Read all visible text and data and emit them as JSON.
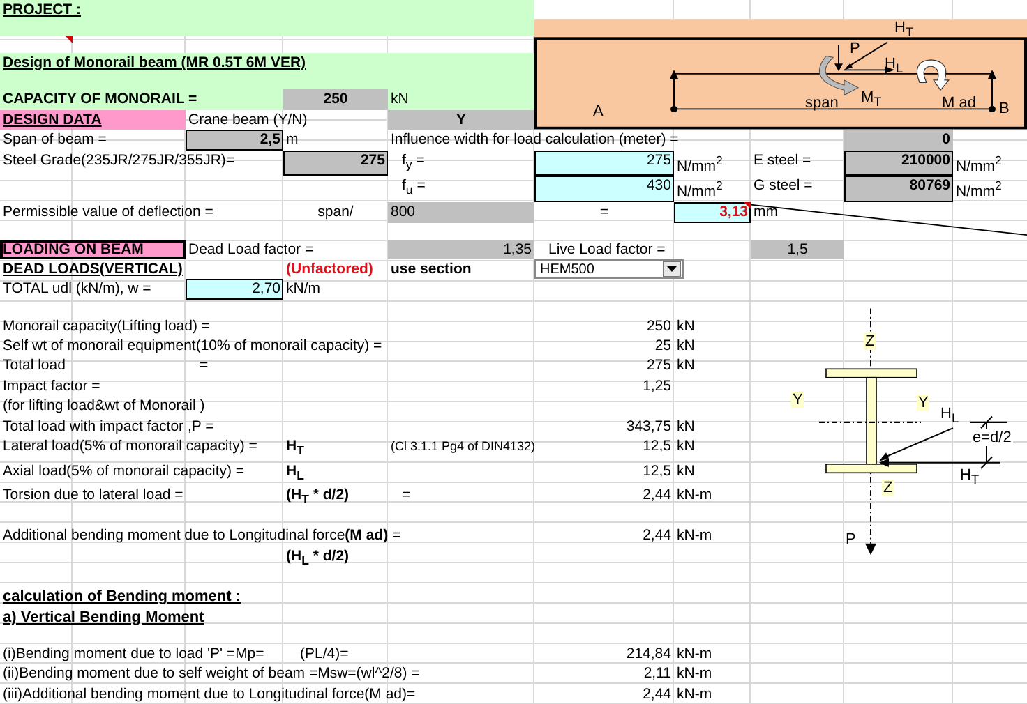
{
  "project_label": "PROJECT :",
  "title": "Design of Monorail beam (MR  0.5T  6M  VER)",
  "capacity": {
    "label": "CAPACITY OF MONORAIL =",
    "value": "250",
    "unit": "kN"
  },
  "beam_diagram": {
    "labels": [
      {
        "kind": "ht",
        "text": "H$_{T}$"
      },
      {
        "kind": "p",
        "text": "P"
      },
      {
        "kind": "hl",
        "text": "H$_{L}$"
      },
      {
        "kind": "span",
        "text": "span"
      },
      {
        "kind": "mt",
        "text": "M$_{T}$"
      },
      {
        "kind": "mad",
        "text": "M ad"
      },
      {
        "kind": "a",
        "text": "A"
      },
      {
        "kind": "b",
        "text": "B"
      }
    ]
  },
  "design_data": {
    "heading": "DESIGN DATA",
    "crane_beam_label": "Crane beam (Y/N)",
    "crane_beam_value": "Y",
    "span": {
      "label": "Span of beam  =",
      "value": "2,5",
      "unit": "m"
    },
    "influence": {
      "label": "Influence width for load calculation (meter) =",
      "value": "0"
    },
    "steel_grade": {
      "label": "Steel Grade(235JR/275JR/355JR)=",
      "value": "275"
    },
    "fy": {
      "label": "f$_{y}$  =",
      "value": "275",
      "unit": "N/mm$^{2}$"
    },
    "fu": {
      "label": "f$_{u}$  =",
      "value": "430",
      "unit": "N/mm$^{2}$"
    },
    "e_steel": {
      "label": "E steel =",
      "value": "210000",
      "unit": "N/mm$^{2}$"
    },
    "g_steel": {
      "label": "G steel =",
      "value": "80769",
      "unit": "N/mm$^{2}$"
    },
    "deflection": {
      "label": "Permissible value of deflection =",
      "span_label": "span/",
      "ratio": "800",
      "equals": "=",
      "value": "3,13",
      "unit": "mm"
    }
  },
  "loading": {
    "heading": "LOADING ON BEAM",
    "dead_factor_label": "Dead  Load factor  =",
    "dead_factor": "1,35",
    "live_factor_label": "Live Load factor   =",
    "live_factor": "1,5",
    "dead_loads_heading": "DEAD LOADS(VERTICAL)",
    "unfactored": "(Unfactored)",
    "use_section_label": "use section",
    "section": "HEM500",
    "udl": {
      "label": "TOTAL udl (kN/m),  w  =",
      "value": "2,70",
      "unit": "kN/m"
    }
  },
  "load_rows": [
    {
      "label": "Monorail capacity(Lifting load) =",
      "value": "250",
      "unit": "kN"
    },
    {
      "label": "Self wt of monorail equipment(10% of monorail capacity) =",
      "value": "25",
      "unit": "kN"
    },
    {
      "label": "Total load",
      "equals": "=",
      "value": "275",
      "unit": "kN"
    },
    {
      "label": "Impact factor =",
      "value": "1,25"
    },
    {
      "label": "(for lifting load&wt of Monorail  )"
    },
    {
      "label": "Total load with impact factor  ,P  =",
      "value": "343,75",
      "unit": "kN"
    },
    {
      "label": "Lateral load(5% of monorail capacity)  =",
      "symbol": "H$_{T}$",
      "note": "(Cl 3.1.1 Pg4 of DIN4132)",
      "value": "12,5",
      "unit": "kN"
    },
    {
      "label": "Axial load(5% of monorail capacity)  =",
      "symbol": "H$_{L}$",
      "value": "12,5",
      "unit": "kN"
    },
    {
      "label": "Torsion due to lateral load =",
      "symbol": "(H$_{T}$ * d/2)",
      "equals": "=",
      "value": "2,44",
      "unit": "kN-m"
    }
  ],
  "additional": {
    "label": "Additional bending moment due to Longitudinal force**(M ad)** =",
    "value": "2,44",
    "unit": "kN-m",
    "symbol": "(H$_{L}$ * d/2)"
  },
  "bending": {
    "heading": "calculation of Bending moment :",
    "subheading": "a) Vertical Bending Moment"
  },
  "moments": [
    {
      "label": "(i)Bending moment due to load 'P' =Mp=",
      "formula": "(PL/4)=",
      "value": "214,84",
      "unit": "kN-m"
    },
    {
      "label": "(ii)Bending moment due to self weight of beam =Msw=(wl^2/8) =",
      "value": "2,11",
      "unit": "kN-m"
    },
    {
      "label": "(iii)Additional bending moment due to Longitudinal force(M ad)=",
      "value": "2,44",
      "unit": "kN-m"
    }
  ],
  "section_diagram": {
    "labels": [
      {
        "kind": "z_top",
        "text": "Z"
      },
      {
        "kind": "z_bottom",
        "text": "Z"
      },
      {
        "kind": "y_left",
        "text": "Y"
      },
      {
        "kind": "y_right",
        "text": "Y"
      },
      {
        "kind": "hl",
        "text": "H$_{L}$"
      },
      {
        "kind": "ht",
        "text": "H$_{T}$"
      },
      {
        "kind": "e",
        "text": "e=d/2"
      },
      {
        "kind": "p",
        "text": "P"
      }
    ]
  }
}
